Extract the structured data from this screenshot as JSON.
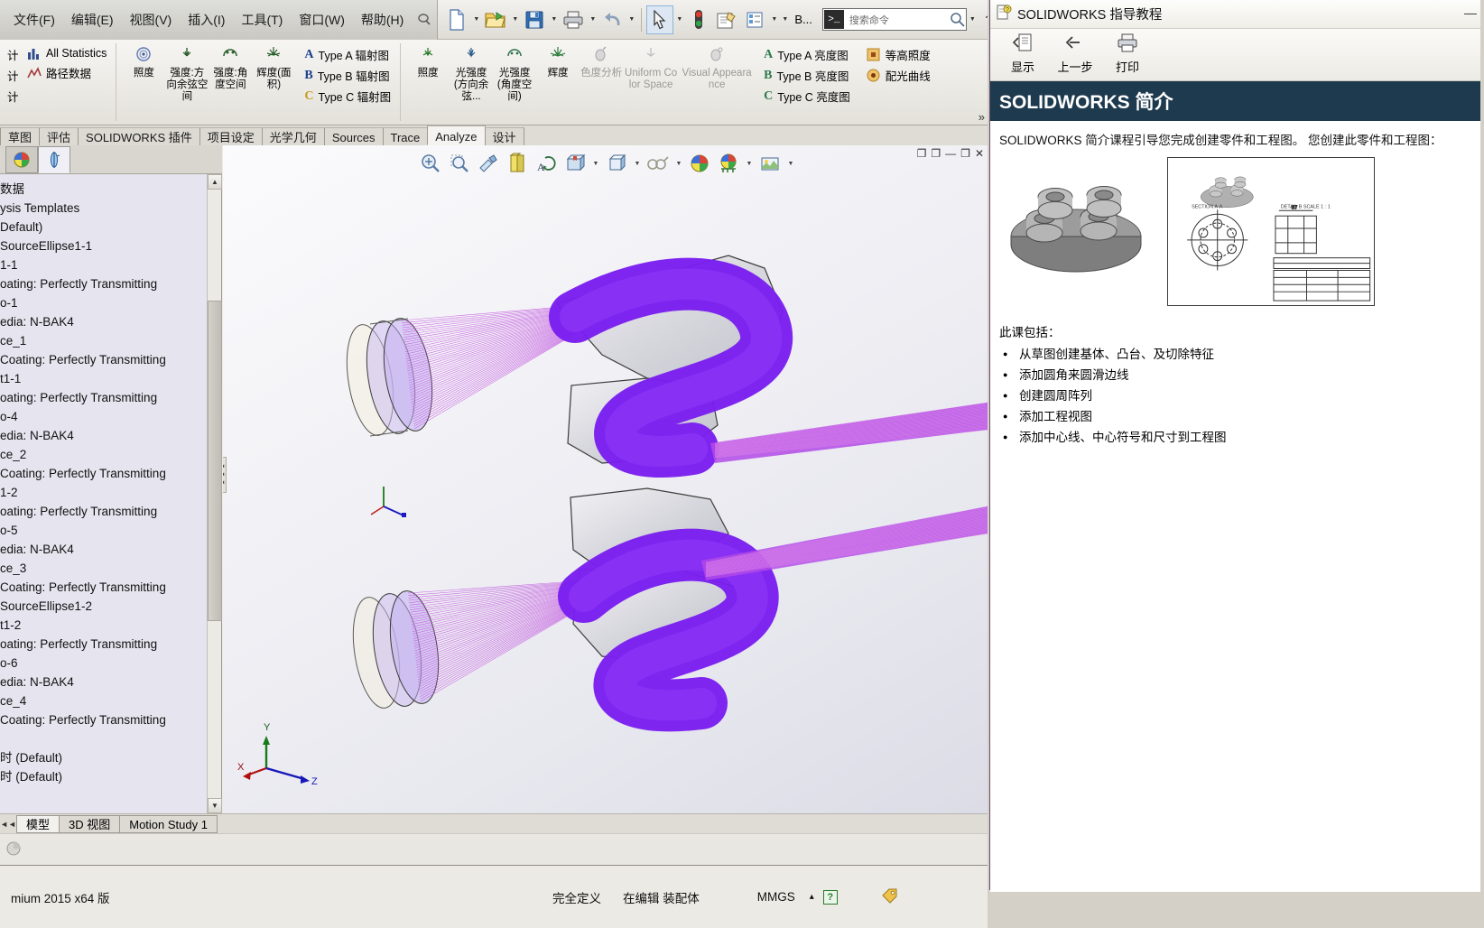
{
  "app": {
    "menu": [
      "文件(F)",
      "编辑(E)",
      "视图(V)",
      "插入(I)",
      "工具(T)",
      "窗口(W)",
      "帮助(H)"
    ],
    "quick_access": [
      {
        "name": "new-document",
        "glyph": "page"
      },
      {
        "name": "open-document",
        "glyph": "folder"
      },
      {
        "name": "save-document",
        "glyph": "floppy"
      },
      {
        "name": "print-document",
        "glyph": "printer"
      },
      {
        "name": "undo",
        "glyph": "undo"
      },
      {
        "name": "select",
        "glyph": "cursor"
      },
      {
        "name": "rebuild",
        "glyph": "traffic"
      },
      {
        "name": "file-properties",
        "glyph": "note"
      },
      {
        "name": "options",
        "glyph": "checklist"
      }
    ],
    "qat_overflow_label": "B...",
    "search": {
      "placeholder": "搜索命令"
    },
    "window_controls": {
      "help": "?",
      "minimize": "—",
      "restore": "❐"
    }
  },
  "ribbon": {
    "col_left": {
      "rows": [
        "计",
        "计",
        "计"
      ],
      "items": [
        {
          "label": "All Statistics",
          "icon": "bar-chart-icon"
        },
        {
          "label": "路径数据",
          "icon": "path-data-icon"
        }
      ]
    },
    "group_irradiance": [
      {
        "label": "照度",
        "icon": "illuminance-icon"
      },
      {
        "label": "强度:方向余弦空间",
        "icon": "intensity-dircos-icon"
      },
      {
        "label": "强度:角度空间",
        "icon": "intensity-angle-icon"
      },
      {
        "label": "辉度(面积)",
        "icon": "luminance-area-icon"
      }
    ],
    "group_typeA": [
      {
        "label": "Type A 辐射图",
        "letter": "A"
      },
      {
        "label": "Type B 辐射图",
        "letter": "B"
      },
      {
        "label": "Type C 辐射图",
        "letter": "C"
      }
    ],
    "group_photometric": [
      {
        "label": "照度",
        "icon": "illuminance2-icon",
        "disabled": false
      },
      {
        "label": "光强度(方向余弦...",
        "icon": "intensity-dircos2-icon",
        "disabled": false
      },
      {
        "label": "光强度(角度空间)",
        "icon": "intensity-angle2-icon",
        "disabled": false
      },
      {
        "label": "辉度",
        "icon": "luminance-icon",
        "disabled": false
      },
      {
        "label": "色度分析",
        "icon": "chromaticity-icon",
        "disabled": true
      },
      {
        "label": "Uniform Color Space",
        "icon": "uniform-color-space-icon",
        "disabled": true
      },
      {
        "label": "Visual Appearance",
        "icon": "visual-appearance-icon",
        "disabled": true
      }
    ],
    "group_typeA_lum": [
      {
        "label": "Type A 亮度图",
        "letter": "A"
      },
      {
        "label": "Type B 亮度图",
        "letter": "B"
      },
      {
        "label": "Type C 亮度图",
        "letter": "C"
      }
    ],
    "group_curves": [
      {
        "label": "等高照度",
        "icon": "iso-illuminance-icon"
      },
      {
        "label": "配光曲线",
        "icon": "light-distribution-curve-icon"
      }
    ],
    "overflow": "»"
  },
  "command_tabs": [
    {
      "label": "草图",
      "active": false
    },
    {
      "label": "评估",
      "active": false
    },
    {
      "label": "SOLIDWORKS 插件",
      "active": false
    },
    {
      "label": "项目设定",
      "active": false
    },
    {
      "label": "光学几何",
      "active": false
    },
    {
      "label": "Sources",
      "active": false
    },
    {
      "label": "Trace",
      "active": false
    },
    {
      "label": "Analyze",
      "active": true
    },
    {
      "label": "设计",
      "active": false
    }
  ],
  "tree": {
    "tabs": [
      {
        "name": "display-manager-tab",
        "active": false
      },
      {
        "name": "feature-manager-tab",
        "active": true
      }
    ],
    "rows": [
      "数据",
      "ysis Templates",
      "Default)",
      "SourceEllipse1-1",
      "1-1",
      "oating: Perfectly Transmitting",
      "o-1",
      "edia: N-BAK4",
      "ce_1",
      " Coating: Perfectly Transmitting",
      "t1-1",
      "oating: Perfectly Transmitting",
      "o-4",
      "edia: N-BAK4",
      "ce_2",
      " Coating: Perfectly Transmitting",
      "1-2",
      "oating: Perfectly Transmitting",
      "o-5",
      "edia: N-BAK4",
      "ce_3",
      " Coating: Perfectly Transmitting",
      "SourceEllipse1-2",
      "t1-2",
      "oating: Perfectly Transmitting",
      "o-6",
      "edia: N-BAK4",
      "ce_4",
      " Coating: Perfectly Transmitting",
      "",
      "时  (Default)",
      "时  (Default)"
    ]
  },
  "viewport": {
    "toolbar": [
      {
        "name": "zoom-to-fit-icon",
        "caret": false
      },
      {
        "name": "zoom-to-area-icon",
        "caret": false
      },
      {
        "name": "section-view-icon",
        "caret": false
      },
      {
        "name": "view-orientation-icon",
        "caret": false
      },
      {
        "name": "apply-scene-icon",
        "caret": false
      },
      {
        "name": "view-settings-icon",
        "caret": true
      },
      {
        "name": "display-style-icon",
        "caret": true
      },
      {
        "name": "hide-show-items-icon",
        "caret": true
      },
      {
        "name": "edit-appearance-icon",
        "caret": false
      },
      {
        "name": "apply-scene2-icon",
        "caret": true
      },
      {
        "name": "view-setting-dropdown-icon",
        "caret": true
      }
    ],
    "window_controls": [
      "❐",
      "❐",
      "—",
      "❐",
      "✕"
    ],
    "triad_axes": [
      "X",
      "Y",
      "Z"
    ],
    "origin_axes": [
      "X",
      "Y",
      "Z"
    ]
  },
  "bottom_tabs": [
    {
      "label": "模型",
      "active": true
    },
    {
      "label": "3D 视图",
      "active": false
    },
    {
      "label": "Motion Study 1",
      "active": false
    }
  ],
  "status_bar": {
    "version": "mium 2015 x64 版",
    "items": [
      "完全定义",
      "在编辑 装配体",
      "MMGS"
    ],
    "units_caret": "▴",
    "help_badge": "?"
  },
  "tutorial": {
    "window_title": "SOLIDWORKS 指导教程",
    "minimize": "—",
    "toolbar": [
      {
        "label": "显示",
        "icon": "show-contents-icon"
      },
      {
        "label": "上一步",
        "icon": "back-arrow-icon"
      },
      {
        "label": "打印",
        "icon": "printer-icon"
      }
    ],
    "banner": "SOLIDWORKS 简介",
    "intro": "SOLIDWORKS 简介课程引导您完成创建零件和工程图。 您创建此零件和工程图：",
    "subtitle": "此课包括：",
    "bullets": [
      "从草图创建基体、凸台、及切除特征",
      "添加圆角来圆滑边线",
      "创建圆周阵列",
      "添加工程视图",
      "添加中心线、中心符号和尺寸到工程图"
    ]
  },
  "colors": {
    "banner_bg": "#1e3a4f",
    "ray_purple": "#7a1ff0",
    "ray_pink": "#e67ae6",
    "viewport_bg": "#f0f0f5"
  }
}
